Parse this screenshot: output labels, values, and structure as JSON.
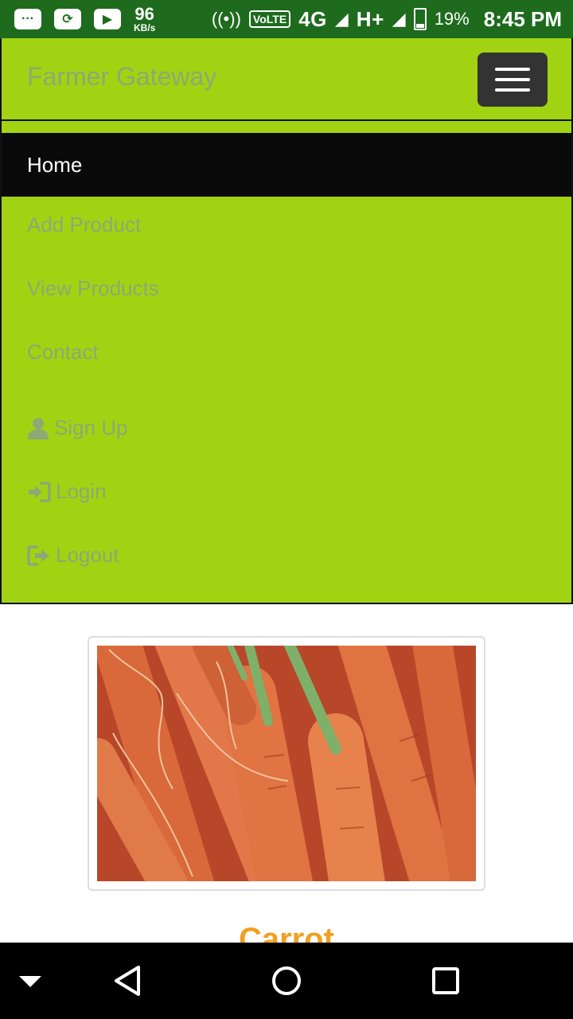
{
  "status_bar": {
    "speed_value": "96",
    "speed_unit": "KB/s",
    "volte": "VoLTE",
    "network": "4G",
    "network_small": "4G",
    "network2": "H+",
    "battery": "19%",
    "time": "8:45 PM"
  },
  "navbar": {
    "brand": "Farmer Gateway"
  },
  "menu": {
    "items": [
      {
        "label": "Home",
        "icon": ""
      },
      {
        "label": "Add Product",
        "icon": ""
      },
      {
        "label": "View Products",
        "icon": ""
      },
      {
        "label": "Contact",
        "icon": ""
      },
      {
        "label": "Sign Up",
        "icon": "user-icon"
      },
      {
        "label": "Login",
        "icon": "login-icon"
      },
      {
        "label": "Logout",
        "icon": "logout-icon"
      }
    ]
  },
  "product": {
    "name": "Carrot",
    "image": "carrot-photo"
  },
  "colors": {
    "brand_green": "#a2d312",
    "status_green": "#1e6b1e",
    "active_bg": "#0a0a0a",
    "product_title": "#f0a020"
  }
}
